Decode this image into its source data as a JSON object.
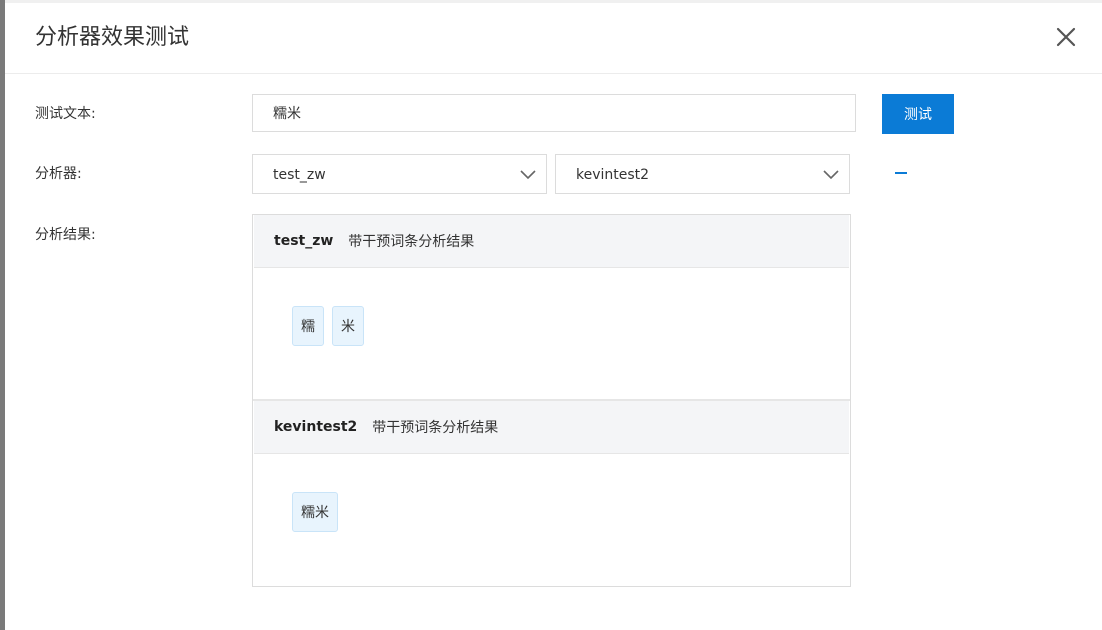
{
  "dialog": {
    "title": "分析器效果测试"
  },
  "form": {
    "test_text_label": "测试文本:",
    "test_text_value": "糯米",
    "test_button_label": "测试",
    "analyzer_label": "分析器:",
    "analyzer_selects": [
      {
        "selected": "test_zw"
      },
      {
        "selected": "kevintest2"
      }
    ],
    "result_label": "分析结果:"
  },
  "results": [
    {
      "name": "test_zw",
      "description": "带干预词条分析结果",
      "tokens": [
        "糯",
        "米"
      ]
    },
    {
      "name": "kevintest2",
      "description": "带干预词条分析结果",
      "tokens": [
        "糯米"
      ]
    }
  ],
  "colors": {
    "primary": "#0b7bd6",
    "token_bg": "#e8f4fd",
    "head_bg": "#f4f5f7",
    "border": "#dcdcdc"
  },
  "icons": {
    "close": "close-icon",
    "dropdown": "chevron-down-icon",
    "remove": "minus-icon"
  }
}
